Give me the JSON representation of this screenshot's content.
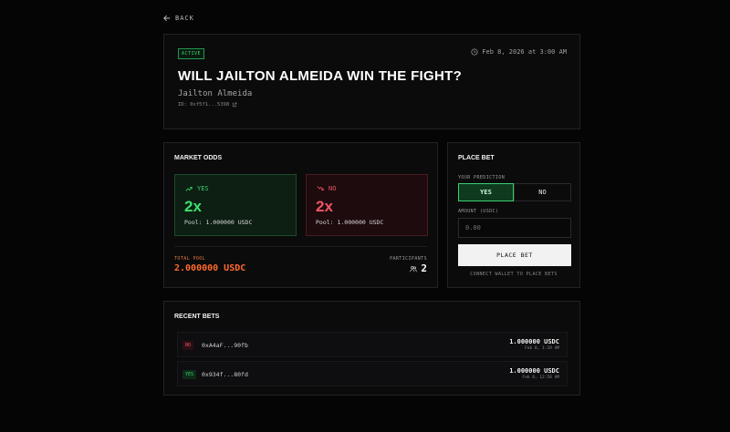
{
  "nav": {
    "back_label": "BACK"
  },
  "market": {
    "status": "ACTIVE",
    "date": "Feb 8, 2026 at 3:00 AM",
    "title": "WILL JAILTON ALMEIDA WIN THE FIGHT?",
    "subtitle": "Jailton Almeida",
    "id": "ID: 0xf5f1...5398"
  },
  "odds": {
    "heading": "MARKET ODDS",
    "yes": {
      "label": "YES",
      "multiplier": "2x",
      "pool": "Pool: 1.000000 USDC"
    },
    "no": {
      "label": "NO",
      "multiplier": "2x",
      "pool": "Pool: 1.000000 USDC"
    },
    "total_pool_label": "TOTAL POOL",
    "total_pool_value": "2.000000 USDC",
    "participants_label": "PARTICIPANTS",
    "participants_value": "2"
  },
  "place_bet": {
    "heading": "PLACE BET",
    "prediction_label": "YOUR PREDICTION",
    "yes_label": "YES",
    "no_label": "NO",
    "selected": "YES",
    "amount_label": "AMOUNT (USDC)",
    "amount_placeholder": "0.00",
    "button_label": "PLACE BET",
    "connect_note": "CONNECT WALLET TO PLACE BETS"
  },
  "recent_bets": {
    "heading": "RECENT BETS",
    "rows": [
      {
        "side": "NO",
        "address": "0xA4aF...90fb",
        "amount": "1.000000 USDC",
        "time": "Feb 8, 1:19 AM"
      },
      {
        "side": "YES",
        "address": "0x934f...80fd",
        "amount": "1.000000 USDC",
        "time": "Feb 8, 12:58 AM"
      }
    ]
  },
  "colors": {
    "yes": "#3ad06c",
    "no": "#e8505f",
    "pool": "#ff6a2b",
    "background": "#050505"
  },
  "icons": [
    "arrow-left-icon",
    "clock-icon",
    "external-link-icon",
    "trend-up-icon",
    "trend-down-icon",
    "users-icon"
  ]
}
